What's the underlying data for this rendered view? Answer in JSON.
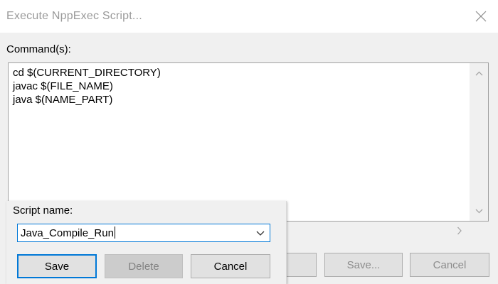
{
  "window": {
    "title": "Execute NppExec Script...",
    "close_icon": "close-icon"
  },
  "commands": {
    "label": "Command(s):",
    "text": "cd $(CURRENT_DIRECTORY)\njavac $(FILE_NAME)\njava $(NAME_PART)"
  },
  "background_buttons": {
    "save_label": "Save...",
    "cancel_label": "Cancel"
  },
  "popup": {
    "script_name_label": "Script name:",
    "script_name_value": "Java_Compile_Run",
    "save_label": "Save",
    "delete_label": "Delete",
    "cancel_label": "Cancel"
  },
  "colors": {
    "accent": "#0078d7",
    "title_text": "#9a9a9a",
    "button_face": "#e1e1e1",
    "disabled_text": "#838383"
  }
}
